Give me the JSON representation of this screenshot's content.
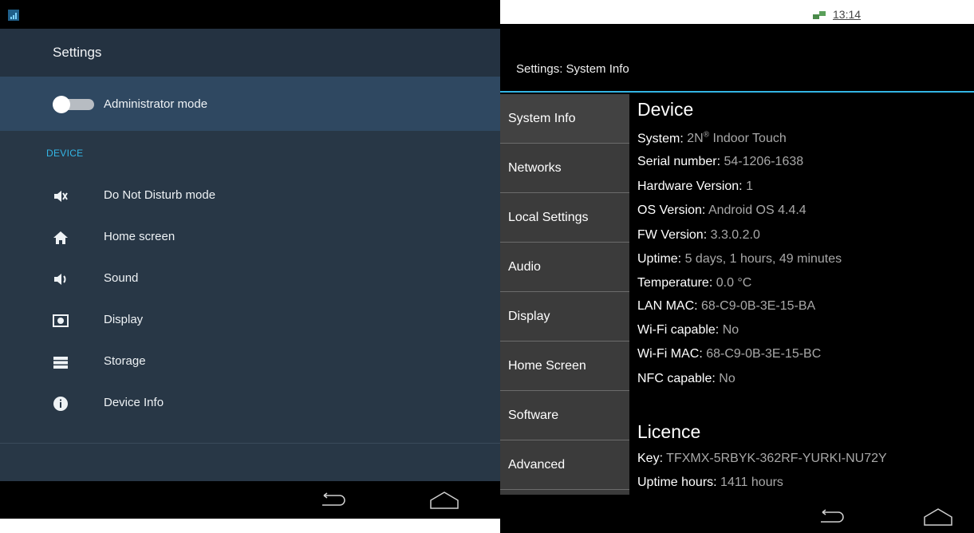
{
  "left": {
    "header_title": "Settings",
    "admin_mode_label": "Administrator mode",
    "section_label": "DEVICE",
    "menu": [
      {
        "label": "Do Not Disturb mode",
        "icon": "mute-icon"
      },
      {
        "label": "Home screen",
        "icon": "home-icon"
      },
      {
        "label": "Sound",
        "icon": "volume-icon"
      },
      {
        "label": "Display",
        "icon": "display-icon"
      },
      {
        "label": "Storage",
        "icon": "storage-icon"
      },
      {
        "label": "Device Info",
        "icon": "info-icon"
      }
    ]
  },
  "right": {
    "status_time": "13:14",
    "title": "Settings: System Info",
    "tabs": [
      "System Info",
      "Networks",
      "Local Settings",
      "Audio",
      "Display",
      "Home Screen",
      "Software",
      "Advanced"
    ],
    "device_heading": "Device",
    "device": {
      "system_key": "System:",
      "system_val": "2N",
      "system_reg": "®",
      "system_val2": " Indoor Touch",
      "serial_key": "Serial number:",
      "serial_val": "54-1206-1638",
      "hw_key": "Hardware Version:",
      "hw_val": "1",
      "os_key": "OS Version:",
      "os_val": "Android OS 4.4.4",
      "fw_key": "FW Version:",
      "fw_val": "3.3.0.2.0",
      "uptime_key": "Uptime:",
      "uptime_val": "5 days, 1 hours, 49 minutes",
      "temp_key": "Temperature:",
      "temp_val": "0.0 °C",
      "lanmac_key": "LAN MAC:",
      "lanmac_val": "68-C9-0B-3E-15-BA",
      "wifi_key": "Wi-Fi capable:",
      "wifi_val": "No",
      "wifimac_key": "Wi-Fi MAC:",
      "wifimac_val": "68-C9-0B-3E-15-BC",
      "nfc_key": "NFC capable:",
      "nfc_val": "No"
    },
    "licence_heading": "Licence",
    "licence": {
      "key_key": "Key:",
      "key_val": "TFXMX-5RBYK-362RF-YURKI-NU72Y",
      "hours_key": "Uptime hours:",
      "hours_val": "1411 hours"
    }
  }
}
